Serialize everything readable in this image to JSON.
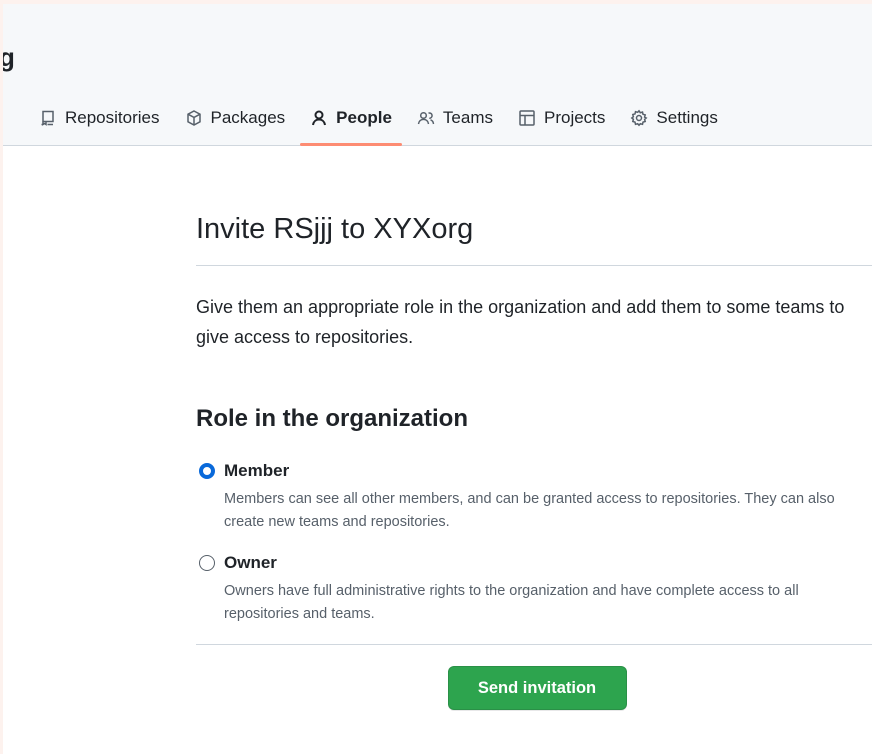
{
  "header": {
    "org_name_fragment": "g",
    "tabs": [
      {
        "label": "Repositories",
        "icon": "repo-icon"
      },
      {
        "label": "Packages",
        "icon": "package-icon"
      },
      {
        "label": "People",
        "icon": "person-icon",
        "selected": true
      },
      {
        "label": "Teams",
        "icon": "people-icon"
      },
      {
        "label": "Projects",
        "icon": "table-icon"
      },
      {
        "label": "Settings",
        "icon": "gear-icon"
      }
    ]
  },
  "invite": {
    "title": "Invite RSjjj to XYXorg",
    "intro": "Give them an appropriate role in the organization and add them to some teams to give access to repositories.",
    "role_heading": "Role in the organization",
    "roles": [
      {
        "label": "Member",
        "description": "Members can see all other members, and can be granted access to repositories. They can also create new teams and repositories.",
        "checked": true
      },
      {
        "label": "Owner",
        "description": "Owners have full administrative rights to the organization and have complete access to all repositories and teams.",
        "checked": false
      }
    ],
    "submit_label": "Send invitation"
  },
  "colors": {
    "selected_tab_underline": "#fd8c73",
    "radio_checked": "#0969da",
    "primary_button": "#2da44e",
    "page_border": "#fdf2ee"
  }
}
